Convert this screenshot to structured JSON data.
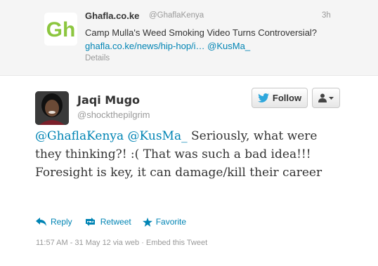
{
  "parent_tweet": {
    "name": "Ghafla.co.ke",
    "handle": "@GhaflaKenya",
    "time": "3h",
    "text_prefix": "Camp Mulla's Weed Smoking Video Turns Controversial?",
    "link": "ghafla.co.ke/news/hip-hop/i…",
    "mention": "@KusMa_",
    "details": "Details",
    "logo_text": "Gh",
    "logo_color": "#8cc63f"
  },
  "tweet": {
    "author_name": "Jaqi Mugo",
    "author_handle": "@shockthepilgrim",
    "follow_label": "Follow",
    "mention1": "@GhaflaKenya",
    "mention2": "@KusMa_",
    "text": "Seriously, what were they thinking?! :( That was such a bad idea!!! Foresight is key, it can damage/kill their career",
    "reply_label": "Reply",
    "retweet_label": "Retweet",
    "favorite_label": "Favorite",
    "meta": "11:57 AM - 31 May 12 via web · Embed this Tweet",
    "link_color": "#0084b4"
  }
}
